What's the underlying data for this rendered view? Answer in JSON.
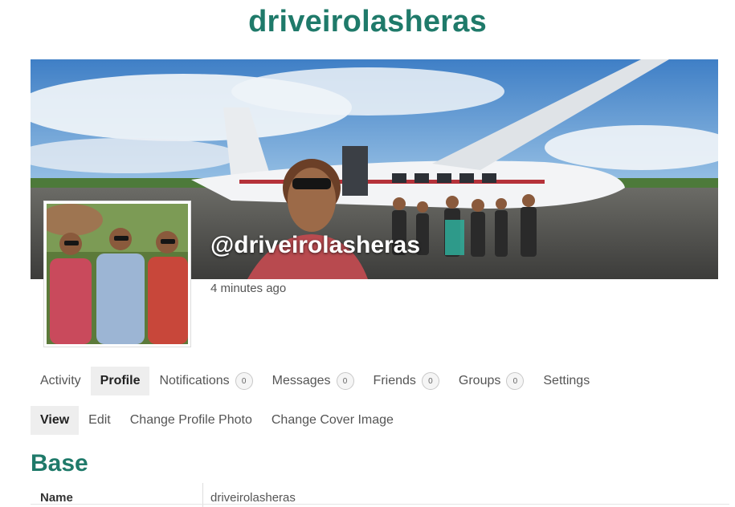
{
  "site": {
    "title": "driveirolasheras"
  },
  "profile": {
    "handle": "@driveirolasheras",
    "last_active": "4 minutes ago"
  },
  "nav": {
    "tabs": [
      {
        "label": "Activity",
        "count": null
      },
      {
        "label": "Profile",
        "count": null,
        "active": true
      },
      {
        "label": "Notifications",
        "count": "0"
      },
      {
        "label": "Messages",
        "count": "0"
      },
      {
        "label": "Friends",
        "count": "0"
      },
      {
        "label": "Groups",
        "count": "0"
      },
      {
        "label": "Settings",
        "count": null
      }
    ],
    "subtabs": [
      {
        "label": "View",
        "active": true
      },
      {
        "label": "Edit"
      },
      {
        "label": "Change Profile Photo"
      },
      {
        "label": "Change Cover Image"
      }
    ]
  },
  "section": {
    "title": "Base",
    "fields": [
      {
        "label": "Name",
        "value": "driveirolasheras"
      }
    ]
  },
  "colors": {
    "accent": "#1f7a6a",
    "tab_active_bg": "#eeeeee"
  }
}
